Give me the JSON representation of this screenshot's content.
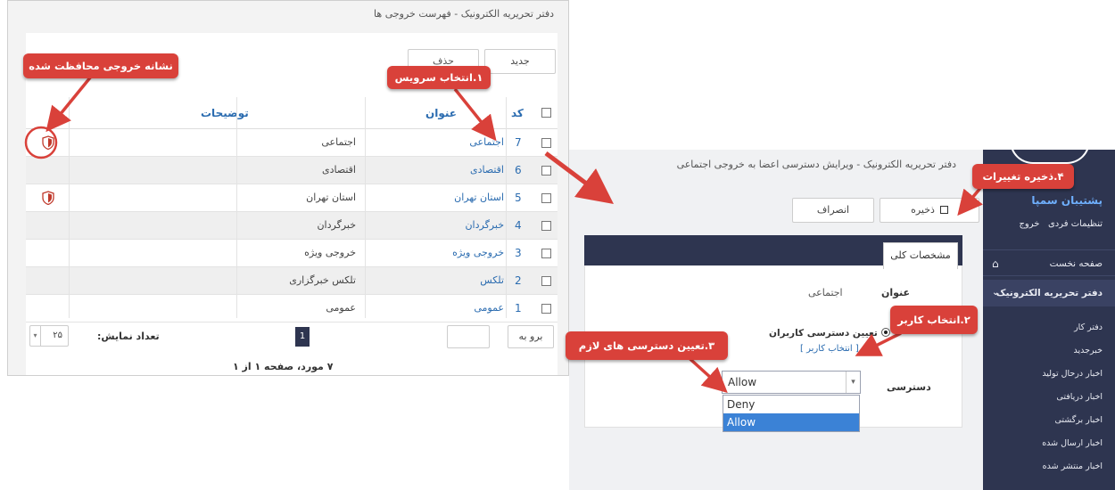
{
  "left": {
    "breadcrumb": "دفتر تحریریه الکترونیک - فهرست خروجی ها",
    "new_button": "جدید",
    "delete_button": "حذف",
    "headers": {
      "code": "کد",
      "title": "عنوان",
      "description": "توضیحات"
    },
    "rows": [
      {
        "code": "7",
        "title": "اجتماعی",
        "description": "اجتماعی",
        "protected": true
      },
      {
        "code": "6",
        "title": "اقتصادی",
        "description": "اقتصادی",
        "protected": false
      },
      {
        "code": "5",
        "title": "استان تهران",
        "description": "استان تهران",
        "protected": true
      },
      {
        "code": "4",
        "title": "خبرگردان",
        "description": "خبرگردان",
        "protected": false
      },
      {
        "code": "3",
        "title": "خروجی ویژه",
        "description": "خروجی ویژه",
        "protected": false
      },
      {
        "code": "2",
        "title": "تلکس",
        "description": "تلکس خبرگزاری",
        "protected": false
      },
      {
        "code": "1",
        "title": "عمومی",
        "description": "عمومی",
        "protected": false
      }
    ],
    "goto_label": "برو به",
    "page_number": "1",
    "display_count_label": "تعداد نمایش:",
    "display_count_value": "۲۵",
    "summary": "۷ مورد، صفحه ۱ از ۱"
  },
  "right": {
    "breadcrumb": "دفتر تحریریه الکترونیک - ویرایش دسترسی اعضا به خروجی اجتماعی",
    "save_button": "ذخیره",
    "cancel_button": "انصراف",
    "tab_general": "مشخصات کلی",
    "field_title_label": "عنوان",
    "field_title_value": "اجتماعی",
    "radio_label": "تعیین دسترسی کاربران",
    "select_user_link": "[ انتخاب کاربر ]",
    "access_label": "دسترسی",
    "access_selected": "Allow",
    "access_options": [
      "Deny",
      "Allow"
    ]
  },
  "sidebar": {
    "brand": "پشتیبان سمپا",
    "personal_settings": "تنظیمات فردی",
    "logout": "خروج",
    "home": "صفحه نخست",
    "newsroom": "دفتر تحریریه الکترونیک",
    "items": [
      "دفتر کار",
      "خبرجدید",
      "اخبار درحال تولید",
      "اخبار دریافتی",
      "اخبار برگشتی",
      "اخبار ارسال شده",
      "اخبار منتشر شده"
    ]
  },
  "callouts": {
    "protected_output": "نشانه خروجی محافظت شده",
    "step1": "۱.انتخاب سرویس",
    "step2": "۲.انتخاب کاربر",
    "step3": "۳.تعیین دسترسی های لازم",
    "step4": "۴.ذخیره تغییرات"
  },
  "colors": {
    "callout": "#d9413a",
    "sidebar": "#2e3550",
    "link": "#2b6cb0",
    "selected": "#3b82d6"
  }
}
